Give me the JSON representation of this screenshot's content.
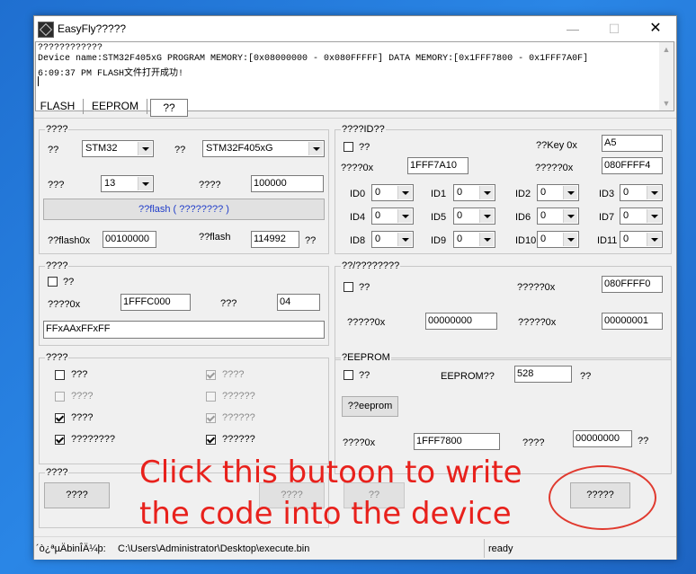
{
  "window": {
    "title": "EasyFly?????",
    "controls": {
      "minimize": "—",
      "maximize": "☐",
      "close": "✕"
    }
  },
  "log": {
    "lines": [
      "????????????",
      "Device name:STM32F405xG PROGRAM MEMORY:[0x08000000 - 0x080FFFFF] DATA MEMORY:[0x1FFF7800 - 0x1FFF7A0F]",
      "6:09:37 PM   FLASH文件打开成功!"
    ]
  },
  "tabs": {
    "flash": "FLASH",
    "eeprom": "EEPROM",
    "active": "??"
  },
  "chip_group": {
    "title": "????",
    "label1": "??",
    "select1": "STM32",
    "label2": "??",
    "select2": "STM32F405xG",
    "label3": "???",
    "select3": "13",
    "label4": "????",
    "value4": "100000",
    "flash_button": "??flash ( ???????? )",
    "start_label": "??flash0x",
    "start_value": "00100000",
    "size_label": "??flash",
    "size_value": "114992",
    "size_unit": "??"
  },
  "id_group": {
    "title": "????ID??",
    "checkbox_label": "??",
    "key_label": "??Key  0x",
    "key_value": "A5",
    "addr_label": "????0x",
    "addr_value": "1FFF7A10",
    "addr2_label": "?????0x",
    "addr2_value": "080FFFF4",
    "ids": [
      {
        "label": "ID0",
        "value": "0"
      },
      {
        "label": "ID1",
        "value": "0"
      },
      {
        "label": "ID2",
        "value": "0"
      },
      {
        "label": "ID3",
        "value": "0"
      },
      {
        "label": "ID4",
        "value": "0"
      },
      {
        "label": "ID5",
        "value": "0"
      },
      {
        "label": "ID6",
        "value": "0"
      },
      {
        "label": "ID7",
        "value": "0"
      },
      {
        "label": "ID8",
        "value": "0"
      },
      {
        "label": "ID9",
        "value": "0"
      },
      {
        "label": "ID10",
        "value": "0"
      },
      {
        "label": "ID11",
        "value": "0"
      }
    ]
  },
  "mem_group": {
    "title": "????",
    "checkbox_label": "??",
    "addr_label": "????0x",
    "addr_value": "1FFFC000",
    "len_label": "???",
    "len_value": "04",
    "data_value": "FFxAAxFFxFF"
  },
  "serial_group": {
    "title": "??/????????",
    "checkbox_label": "??",
    "label1": "?????0x",
    "value1": "080FFFF0",
    "label2": "?????0x",
    "value2": "00000000",
    "label3": "?????0x",
    "value3": "00000001"
  },
  "options_group": {
    "title": "????",
    "items": [
      {
        "label": "???",
        "checked": false,
        "disabled": false
      },
      {
        "label": "????",
        "checked": true,
        "disabled": true
      },
      {
        "label": "????",
        "checked": false,
        "disabled": true
      },
      {
        "label": "??????",
        "checked": false,
        "disabled": true
      },
      {
        "label": "????",
        "checked": true,
        "disabled": false
      },
      {
        "label": "??????",
        "checked": true,
        "disabled": true
      },
      {
        "label": "????????",
        "checked": true,
        "disabled": false
      },
      {
        "label": "??????",
        "checked": true,
        "disabled": false
      }
    ]
  },
  "eeprom_group": {
    "title": "?EEPROM",
    "checkbox_label": "??",
    "size_label": "EEPROM??",
    "size_value": "528",
    "size_unit": "??",
    "button": "??eeprom",
    "addr_label": "????0x",
    "addr_value": "1FFF7800",
    "val_label": "????",
    "val_value": "00000000",
    "val_unit": "??"
  },
  "bottom_group": {
    "title": "????",
    "btn1": "????",
    "btn2": "????",
    "btn3": "??",
    "write_button": "?????"
  },
  "status": {
    "path_label": "´ò¿ªµÄbinÎÄ¼þ:",
    "path": "C:\\Users\\Administrator\\Desktop\\execute.bin",
    "state": "ready"
  },
  "annotation": {
    "line1": "Click this butoon to write",
    "line2": "the code into the device",
    "color": "#e8211c"
  }
}
